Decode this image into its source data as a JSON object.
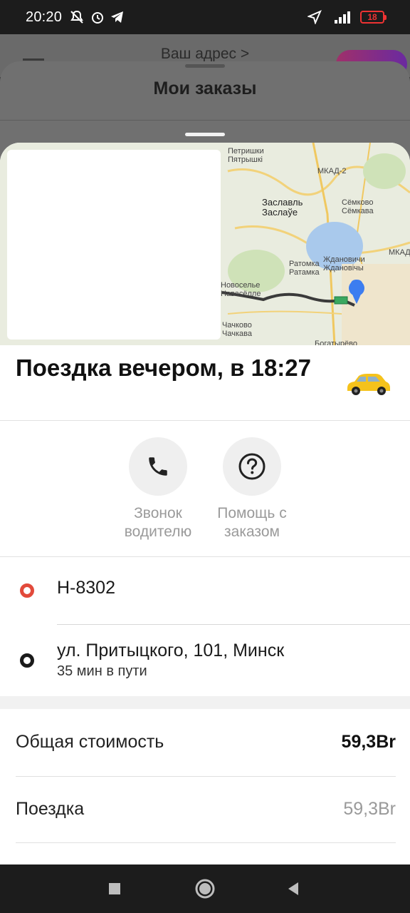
{
  "status_bar": {
    "time": "20:20",
    "battery": "18"
  },
  "background": {
    "address_label": "Ваш адрес >"
  },
  "orders_sheet": {
    "title": "Мои заказы"
  },
  "map": {
    "labels": [
      "Петришки",
      "Пятрышкі",
      "МКАД-2",
      "Заславль",
      "Заслаўе",
      "Сёмково",
      "Сёмкава",
      "Ратомка",
      "Ратамка",
      "Ждановичи",
      "Ждановічы",
      "Новоселье",
      "Навасёлле",
      "Чачково",
      "Чачкава",
      "Богатырёво",
      "МКАД"
    ],
    "route_color": "#3a3a3a",
    "pin_color": "#3c7df0"
  },
  "trip": {
    "title": "Поездка вечером, в 18:27",
    "car_icon": "taxi-car-icon"
  },
  "actions": [
    {
      "label": "Звонок водителю",
      "icon": "phone-icon"
    },
    {
      "label": "Помощь с заказом",
      "icon": "question-icon"
    }
  ],
  "route": {
    "start": {
      "text": "Н-8302",
      "marker_color": "#e24a3b"
    },
    "end": {
      "text": "ул. Притыцкого, 101, Минск",
      "duration": "35 мин в пути",
      "marker_color": "#1a1a1a"
    }
  },
  "cost": {
    "total_label": "Общая стоимость",
    "total_value": "59,3Br",
    "trip_label": "Поездка",
    "trip_value": "59,3Br"
  }
}
